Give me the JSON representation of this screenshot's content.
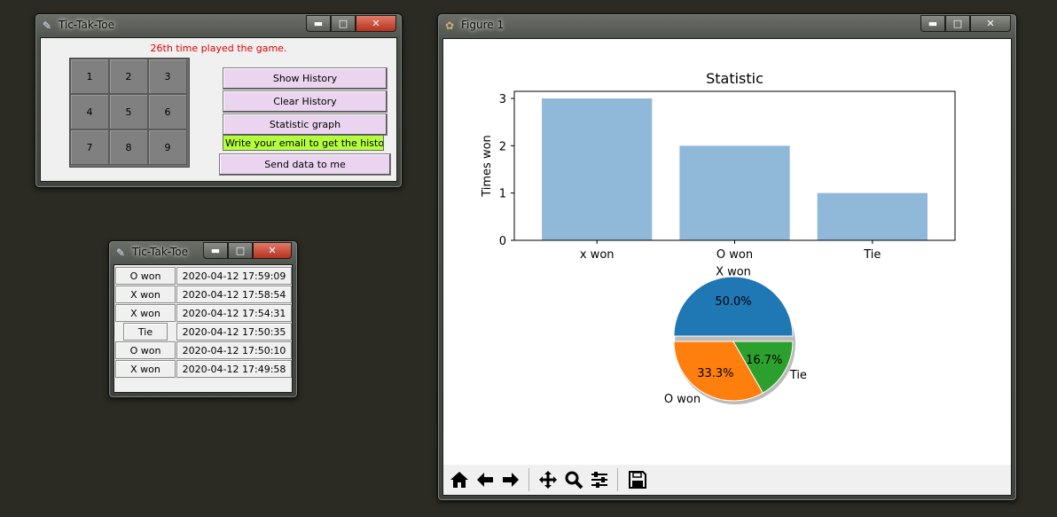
{
  "game_window": {
    "title": "Tic-Tak-Toe",
    "status": "26th time played the game.",
    "status_color": "#e00000",
    "cells": [
      "1",
      "2",
      "3",
      "4",
      "5",
      "6",
      "7",
      "8",
      "9"
    ],
    "buttons": {
      "show_history": "Show History",
      "clear_history": "Clear History",
      "statistic_graph": "Statistic graph",
      "send": "Send data to me"
    },
    "email_value": "Write your email to get the history",
    "button_color": "#ead4ef",
    "email_color": "#b4ff3c"
  },
  "history_window": {
    "title": "Tic-Tak-Toe",
    "rows": [
      {
        "result": "O won",
        "time": "2020-04-12 17:59:09"
      },
      {
        "result": "X won",
        "time": "2020-04-12 17:58:54"
      },
      {
        "result": "X won",
        "time": "2020-04-12 17:54:31"
      },
      {
        "result": "Tie",
        "time": "2020-04-12 17:50:35"
      },
      {
        "result": "O won",
        "time": "2020-04-12 17:50:10"
      },
      {
        "result": "X won",
        "time": "2020-04-12 17:49:58"
      }
    ]
  },
  "figure_window": {
    "title": "Figure 1",
    "toolbar_icons": [
      "home-icon",
      "back-icon",
      "forward-icon",
      "pan-icon",
      "zoom-icon",
      "configure-icon",
      "save-icon"
    ]
  },
  "window_controls": {
    "minimize": "▬",
    "maximize": "□",
    "close": "✕"
  },
  "chart_data": [
    {
      "type": "bar",
      "title": "Statistic",
      "xlabel": "",
      "ylabel": "Times won",
      "categories": [
        "x won",
        "O won",
        "Tie"
      ],
      "values": [
        3,
        2,
        1
      ],
      "ylim": [
        0,
        3.15
      ],
      "yticks": [
        "0",
        "1",
        "2",
        "3"
      ],
      "color": "#8fb8d9"
    },
    {
      "type": "pie",
      "labels": [
        "X won",
        "O won",
        "Tie"
      ],
      "values": [
        50.0,
        33.3,
        16.7
      ],
      "pct_labels": [
        "50.0%",
        "33.3%",
        "16.7%"
      ],
      "colors": [
        "#1f77b4",
        "#ff7f0e",
        "#2ca02c"
      ],
      "explode": true,
      "shadow": true
    }
  ]
}
